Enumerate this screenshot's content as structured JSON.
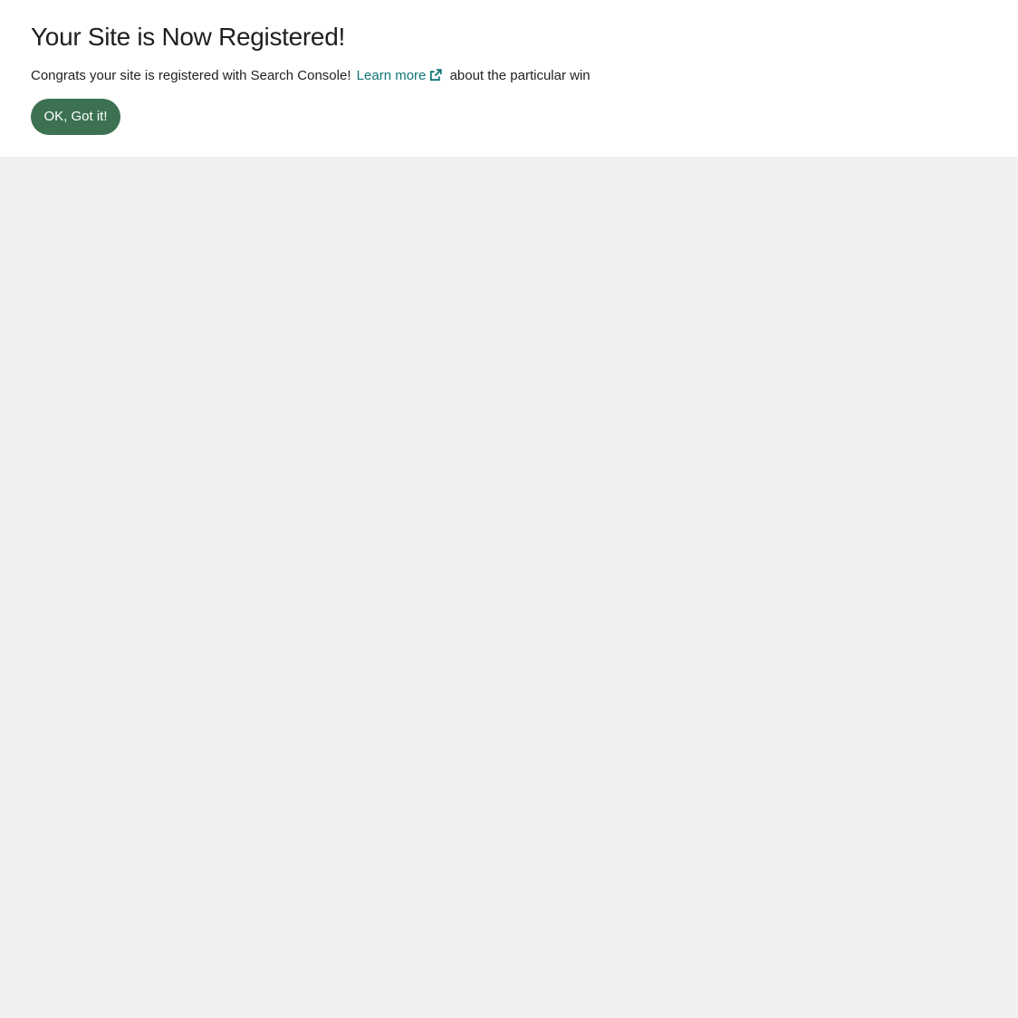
{
  "notice": {
    "title": "Your Site is Now Registered!",
    "message_before": "Congrats your site is registered with Search Console!",
    "learn_more_label": "Learn more",
    "link_icon": "external-link-icon",
    "message_after": "about the particular win",
    "ok_button_label": "OK, Got it!"
  },
  "colors": {
    "link": "#107576",
    "button_background": "#3c7251",
    "button_text": "#ffffff",
    "notice_background": "#ffffff",
    "page_background": "#f0f0f0",
    "text": "#1f1f1f"
  }
}
